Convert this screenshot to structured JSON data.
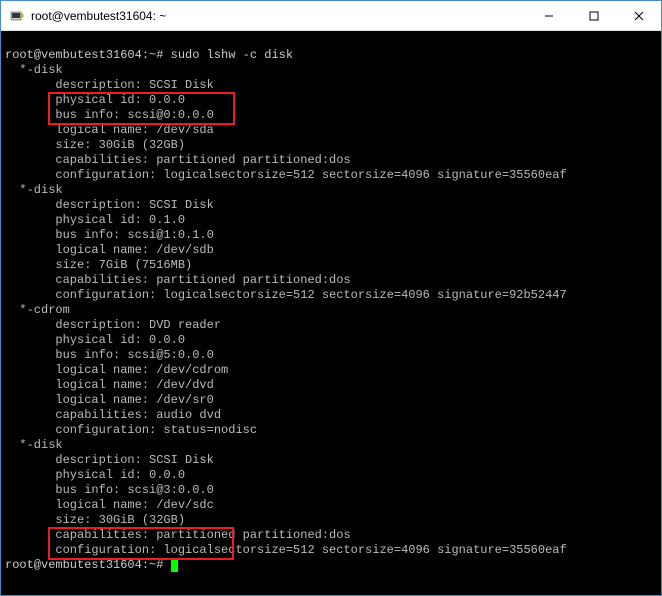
{
  "window": {
    "title": "root@vembutest31604: ~"
  },
  "prompt": {
    "text": "root@vembutest31604:~#",
    "command": "sudo lshw -c disk"
  },
  "output": {
    "disk1": {
      "header": "  *-disk",
      "description": "       description: SCSI Disk",
      "physical_id": "       physical id: 0.0.0",
      "bus_info": "       bus info: scsi@0:0.0.0",
      "logical_name": "       logical name: /dev/sda",
      "size": "       size: 30GiB (32GB)",
      "capabilities": "       capabilities: partitioned partitioned:dos",
      "configuration": "       configuration: logicalsectorsize=512 sectorsize=4096 signature=35560eaf"
    },
    "disk2": {
      "header": "  *-disk",
      "description": "       description: SCSI Disk",
      "physical_id": "       physical id: 0.1.0",
      "bus_info": "       bus info: scsi@1:0.1.0",
      "logical_name": "       logical name: /dev/sdb",
      "size": "       size: 7GiB (7516MB)",
      "capabilities": "       capabilities: partitioned partitioned:dos",
      "configuration": "       configuration: logicalsectorsize=512 sectorsize=4096 signature=92b52447"
    },
    "cdrom": {
      "header": "  *-cdrom",
      "description": "       description: DVD reader",
      "physical_id": "       physical id: 0.0.0",
      "bus_info": "       bus info: scsi@5:0.0.0",
      "logical_name1": "       logical name: /dev/cdrom",
      "logical_name2": "       logical name: /dev/dvd",
      "logical_name3": "       logical name: /dev/sr0",
      "capabilities": "       capabilities: audio dvd",
      "configuration": "       configuration: status=nodisc"
    },
    "disk3": {
      "header": "  *-disk",
      "description": "       description: SCSI Disk",
      "physical_id": "       physical id: 0.0.0",
      "bus_info": "       bus info: scsi@3:0.0.0",
      "logical_name": "       logical name: /dev/sdc",
      "size": "       size: 30GiB (32GB)",
      "capabilities": "       capabilities: partitioned partitioned:dos",
      "configuration": "       configuration: logicalsectorsize=512 sectorsize=4096 signature=35560eaf"
    }
  }
}
